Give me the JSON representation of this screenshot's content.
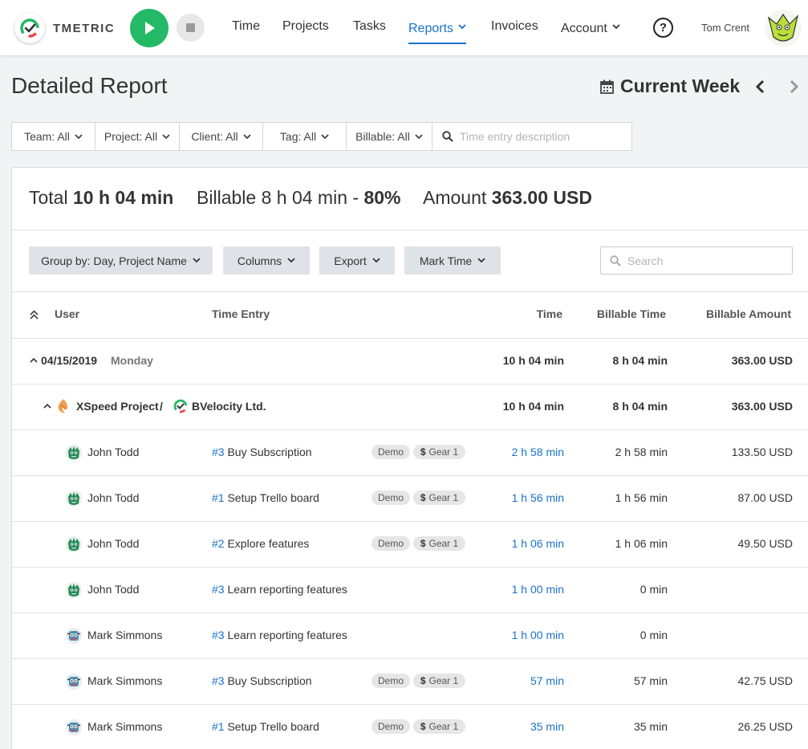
{
  "app": {
    "brand": "TMETRIC",
    "nav": [
      "Time",
      "Projects",
      "Tasks",
      "Reports",
      "Invoices",
      "Account"
    ],
    "active_nav": "Reports",
    "user_name": "Tom Crent",
    "accent": "#1a73c9",
    "play_color": "#23b966"
  },
  "page": {
    "title": "Detailed Report",
    "period": "Current Week"
  },
  "filters": {
    "team": "Team: All",
    "project": "Project: All",
    "client": "Client: All",
    "tag": "Tag: All",
    "billable": "Billable: All",
    "search_placeholder": "Time entry description"
  },
  "summary": {
    "total_label": "Total",
    "total_value": "10 h 04 min",
    "billable_label": "Billable 8 h 04 min -",
    "billable_pct": "80%",
    "amount_label": "Amount",
    "amount_value": "363.00 USD"
  },
  "toolbar": {
    "group_by": "Group by: Day, Project Name",
    "columns": "Columns",
    "export": "Export",
    "mark_time": "Mark Time",
    "search_placeholder": "Search"
  },
  "table": {
    "headers": {
      "user": "User",
      "entry": "Time Entry",
      "time": "Time",
      "billable_time": "Billable Time",
      "billable_amount": "Billable Amount"
    },
    "day_group": {
      "date": "04/15/2019",
      "weekday": "Monday",
      "time": "10 h 04 min",
      "billable_time": "8 h 04 min",
      "amount": "363.00 USD"
    },
    "project_group": {
      "project": "XSpeed Project",
      "separator": "/",
      "client": "BVelocity Ltd.",
      "time": "10 h 04 min",
      "billable_time": "8 h 04 min",
      "amount": "363.00 USD"
    },
    "rows": [
      {
        "user": "John Todd",
        "task_id": "#3",
        "task": "Buy Subscription",
        "tags": [
          "Demo",
          "Gear 1"
        ],
        "time": "2 h 58 min",
        "billable_time": "2 h 58 min",
        "amount": "133.50 USD"
      },
      {
        "user": "John Todd",
        "task_id": "#1",
        "task": "Setup Trello board",
        "tags": [
          "Demo",
          "Gear 1"
        ],
        "time": "1 h 56 min",
        "billable_time": "1 h 56 min",
        "amount": "87.00 USD"
      },
      {
        "user": "John Todd",
        "task_id": "#2",
        "task": "Explore features",
        "tags": [
          "Demo",
          "Gear 1"
        ],
        "time": "1 h 06 min",
        "billable_time": "1 h 06 min",
        "amount": "49.50 USD"
      },
      {
        "user": "John Todd",
        "task_id": "#3",
        "task": "Learn reporting features",
        "tags": [],
        "time": "1 h 00 min",
        "billable_time": "0 min",
        "amount": ""
      },
      {
        "user": "Mark Simmons",
        "task_id": "#3",
        "task": "Learn reporting features",
        "tags": [],
        "time": "1 h 00 min",
        "billable_time": "0 min",
        "amount": ""
      },
      {
        "user": "Mark Simmons",
        "task_id": "#3",
        "task": "Buy Subscription",
        "tags": [
          "Demo",
          "Gear 1"
        ],
        "time": "57 min",
        "billable_time": "57 min",
        "amount": "42.75 USD"
      },
      {
        "user": "Mark Simmons",
        "task_id": "#1",
        "task": "Setup Trello board",
        "tags": [
          "Demo",
          "Gear 1"
        ],
        "time": "35 min",
        "billable_time": "35 min",
        "amount": "26.25 USD"
      }
    ]
  }
}
